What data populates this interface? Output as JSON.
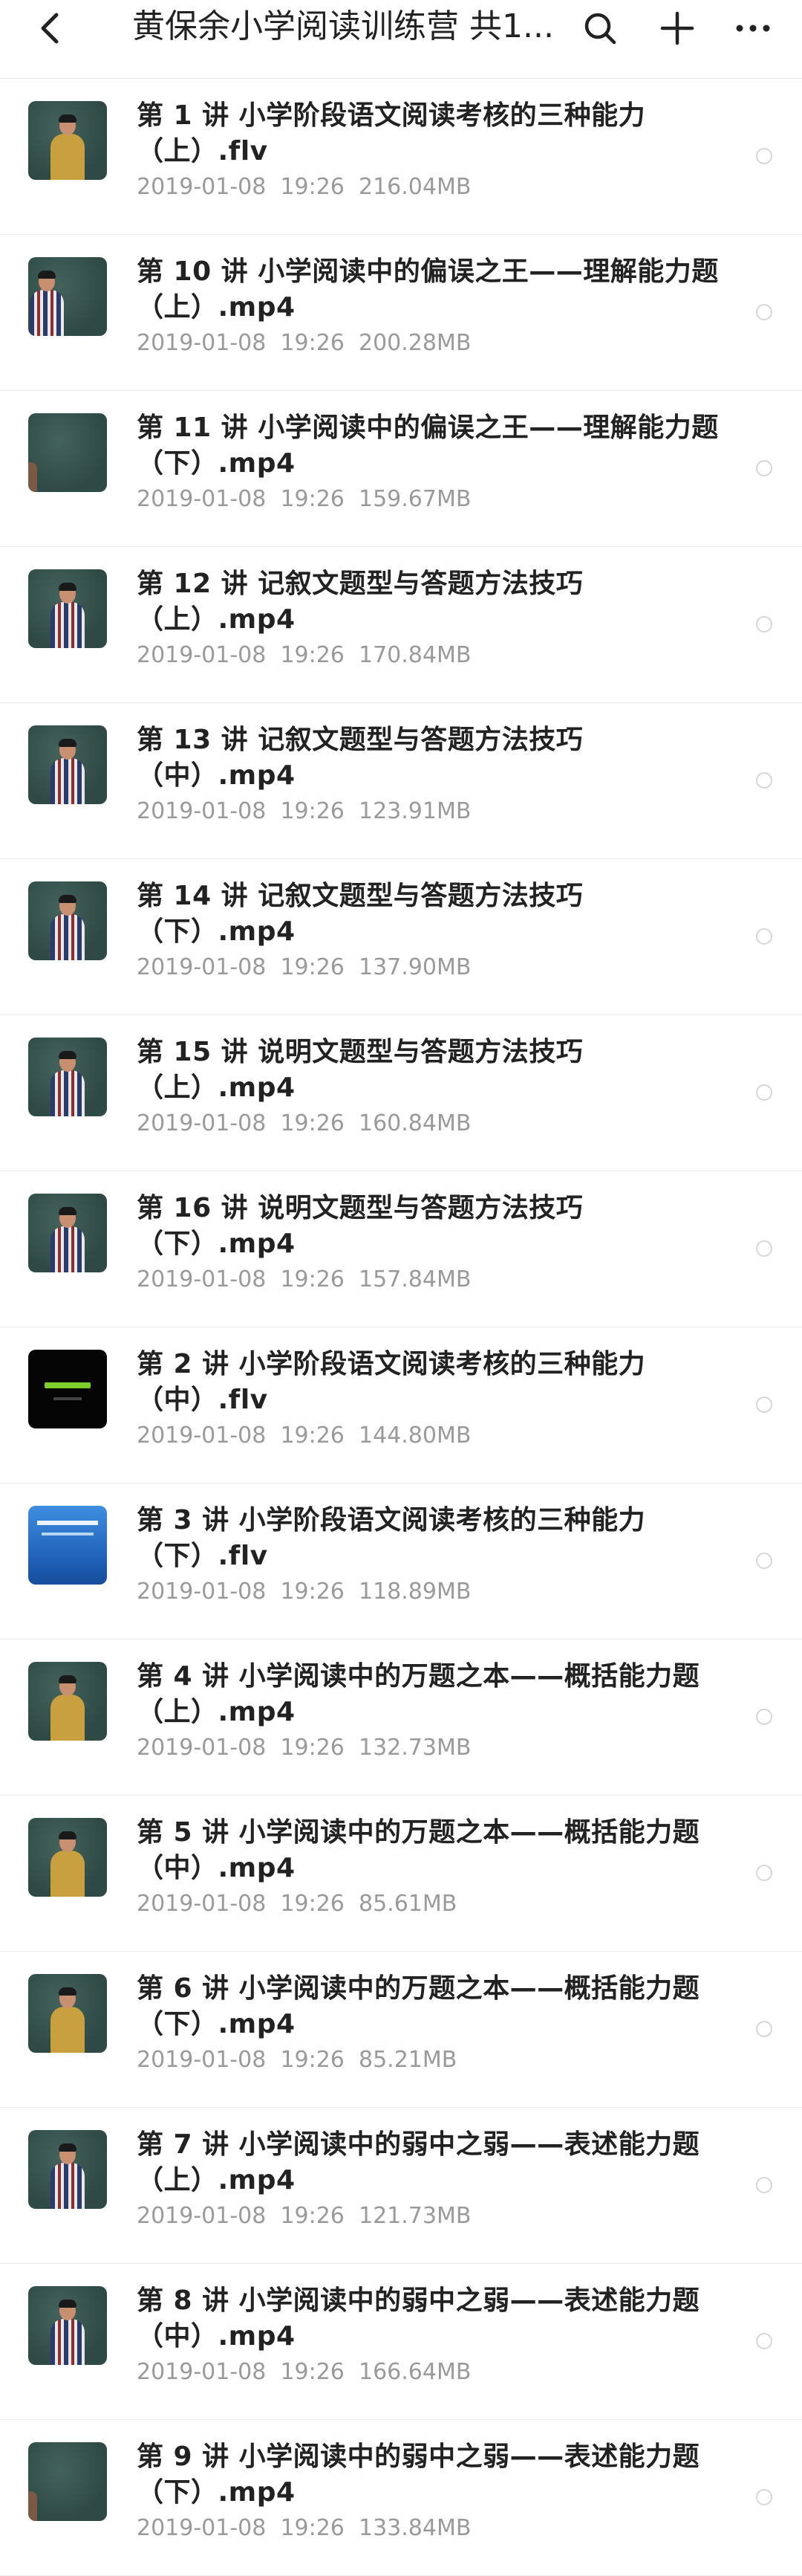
{
  "header": {
    "title": "黄保余小学阅读训练营 共1...",
    "back_icon": "chevron-left-icon",
    "search_icon": "search-icon",
    "add_icon": "plus-icon",
    "more_icon": "more-horizontal-icon"
  },
  "files": [
    {
      "title": "第 1 讲 小学阶段语文阅读考核的三种能力（上）.flv",
      "date": "2019-01-08",
      "time": "19:26",
      "size": "216.04MB",
      "thumb": "teacher-yellow"
    },
    {
      "title": "第 10 讲 小学阅读中的偏误之王——理解能力题（上）.mp4",
      "date": "2019-01-08",
      "time": "19:26",
      "size": "200.28MB",
      "thumb": "board-small"
    },
    {
      "title": "第 11 讲 小学阅读中的偏误之王——理解能力题（下）.mp4",
      "date": "2019-01-08",
      "time": "19:26",
      "size": "159.67MB",
      "thumb": "board-edge"
    },
    {
      "title": "第 12 讲 记叙文题型与答题方法技巧（上）.mp4",
      "date": "2019-01-08",
      "time": "19:26",
      "size": "170.84MB",
      "thumb": "teacher-plaid"
    },
    {
      "title": "第 13 讲 记叙文题型与答题方法技巧（中）.mp4",
      "date": "2019-01-08",
      "time": "19:26",
      "size": "123.91MB",
      "thumb": "teacher-plaid"
    },
    {
      "title": "第 14 讲 记叙文题型与答题方法技巧（下）.mp4",
      "date": "2019-01-08",
      "time": "19:26",
      "size": "137.90MB",
      "thumb": "teacher-plaid"
    },
    {
      "title": "第 15 讲 说明文题型与答题方法技巧（上）.mp4",
      "date": "2019-01-08",
      "time": "19:26",
      "size": "160.84MB",
      "thumb": "teacher-plaid"
    },
    {
      "title": "第 16 讲 说明文题型与答题方法技巧（下）.mp4",
      "date": "2019-01-08",
      "time": "19:26",
      "size": "157.84MB",
      "thumb": "teacher-plaid"
    },
    {
      "title": "第 2 讲 小学阶段语文阅读考核的三种能力（中）.flv",
      "date": "2019-01-08",
      "time": "19:26",
      "size": "144.80MB",
      "thumb": "dark-title"
    },
    {
      "title": "第 3 讲 小学阶段语文阅读考核的三种能力（下）.flv",
      "date": "2019-01-08",
      "time": "19:26",
      "size": "118.89MB",
      "thumb": "blue-slide"
    },
    {
      "title": "第 4 讲 小学阅读中的万题之本——概括能力题（上）.mp4",
      "date": "2019-01-08",
      "time": "19:26",
      "size": "132.73MB",
      "thumb": "teacher-yellow"
    },
    {
      "title": "第 5 讲 小学阅读中的万题之本——概括能力题（中）.mp4",
      "date": "2019-01-08",
      "time": "19:26",
      "size": "85.61MB",
      "thumb": "teacher-yellow"
    },
    {
      "title": "第 6 讲 小学阅读中的万题之本——概括能力题（下）.mp4",
      "date": "2019-01-08",
      "time": "19:26",
      "size": "85.21MB",
      "thumb": "teacher-yellow"
    },
    {
      "title": "第 7 讲 小学阅读中的弱中之弱——表述能力题（上）.mp4",
      "date": "2019-01-08",
      "time": "19:26",
      "size": "121.73MB",
      "thumb": "teacher-plaid"
    },
    {
      "title": "第 8 讲 小学阅读中的弱中之弱——表述能力题（中）.mp4",
      "date": "2019-01-08",
      "time": "19:26",
      "size": "166.64MB",
      "thumb": "teacher-plaid"
    },
    {
      "title": "第 9 讲 小学阅读中的弱中之弱——表述能力题（下）.mp4",
      "date": "2019-01-08",
      "time": "19:26",
      "size": "133.84MB",
      "thumb": "board-edge"
    }
  ],
  "colors": {
    "title_text": "#222222",
    "meta_text": "#9a9a9a",
    "divider": "#ececec",
    "radio_border": "#d6d6d6",
    "chalkboard": "#2f4a45"
  }
}
